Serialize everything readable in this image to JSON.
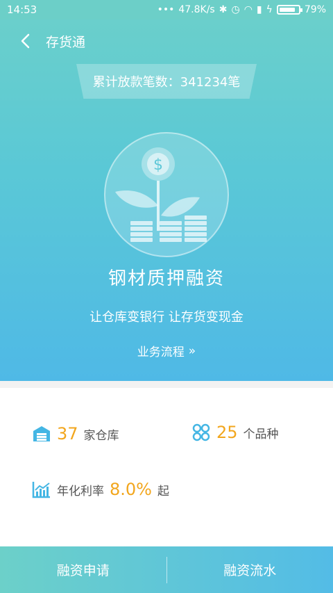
{
  "status_bar": {
    "time": "14:53",
    "network_speed": "47.8K/s",
    "battery": "79%"
  },
  "header": {
    "title": "存货通"
  },
  "banner": {
    "count_text": "累计放款笔数：341234笔"
  },
  "product": {
    "name": "钢材质押融资",
    "slogan": "让仓库变银行 让存货变现金",
    "process_label": "业务流程",
    "process_arrow": "»"
  },
  "stats": {
    "warehouses": {
      "value": "37",
      "unit": "家仓库"
    },
    "varieties": {
      "value": "25",
      "unit": "个品种"
    },
    "rate": {
      "prefix": "年化利率",
      "value": "8.0%",
      "suffix": "起"
    }
  },
  "bottom_bar": {
    "apply_label": "融资申请",
    "records_label": "融资流水"
  },
  "colors": {
    "accent_orange": "#f2a61d",
    "brand_teal": "#6cd0c9",
    "brand_blue": "#53bce6"
  }
}
